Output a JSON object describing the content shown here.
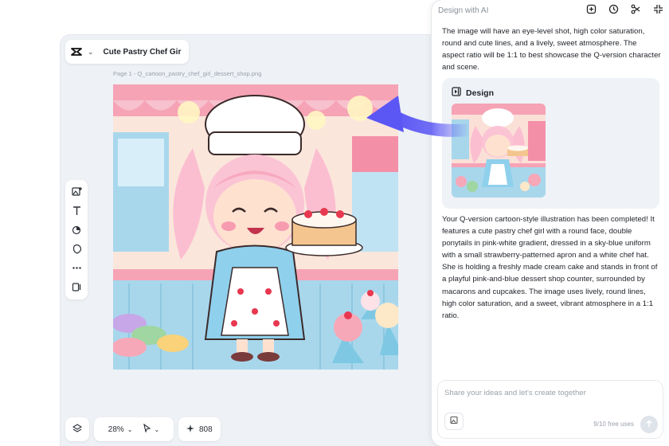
{
  "editor": {
    "project_title": "Cute Pastry Chef Gir",
    "page_label": "Page 1 -   Q_cartoon_pastry_chef_girl_dessert_shop.png",
    "toolbar": {
      "tools": [
        {
          "name": "add-image-tool",
          "icon": "image-plus-icon"
        },
        {
          "name": "text-tool",
          "icon": "text-icon"
        },
        {
          "name": "shape-tool",
          "icon": "shape-icon"
        },
        {
          "name": "sticker-tool",
          "icon": "sticker-icon"
        },
        {
          "name": "more-tool",
          "icon": "more-icon"
        },
        {
          "name": "panel-tool",
          "icon": "panel-icon"
        }
      ]
    },
    "bottom_bar": {
      "zoom": "28%",
      "credits": "808"
    }
  },
  "ai_panel": {
    "title": "Design with AI",
    "intro_text": "The image will have an eye-level shot, high color saturation, round and cute lines, and a lively, sweet atmosphere. The aspect ratio will be 1:1 to best showcase the Q-version character and scene.",
    "design_label": "Design",
    "result_text": "Your Q-version cartoon-style illustration has been completed! It features a cute pastry chef girl with a round face, double ponytails in pink-white gradient, dressed in a sky-blue uniform with a small strawberry-patterned apron and a white chef hat. She is holding a freshly made cream cake and stands in front of a playful pink-and-blue dessert shop counter, surrounded by macarons and cupcakes. The image uses lively, round lines, high color saturation, and a sweet, vibrant atmosphere in a 1:1 ratio.",
    "prompt_placeholder": "Share your ideas and let's create together",
    "free_uses": "9/10 free uses"
  },
  "colors": {
    "accent": "#5b57f5",
    "panel_bg": "#ffffff",
    "canvas_bg": "#eef1f5",
    "card_bg": "#eff2f6"
  }
}
